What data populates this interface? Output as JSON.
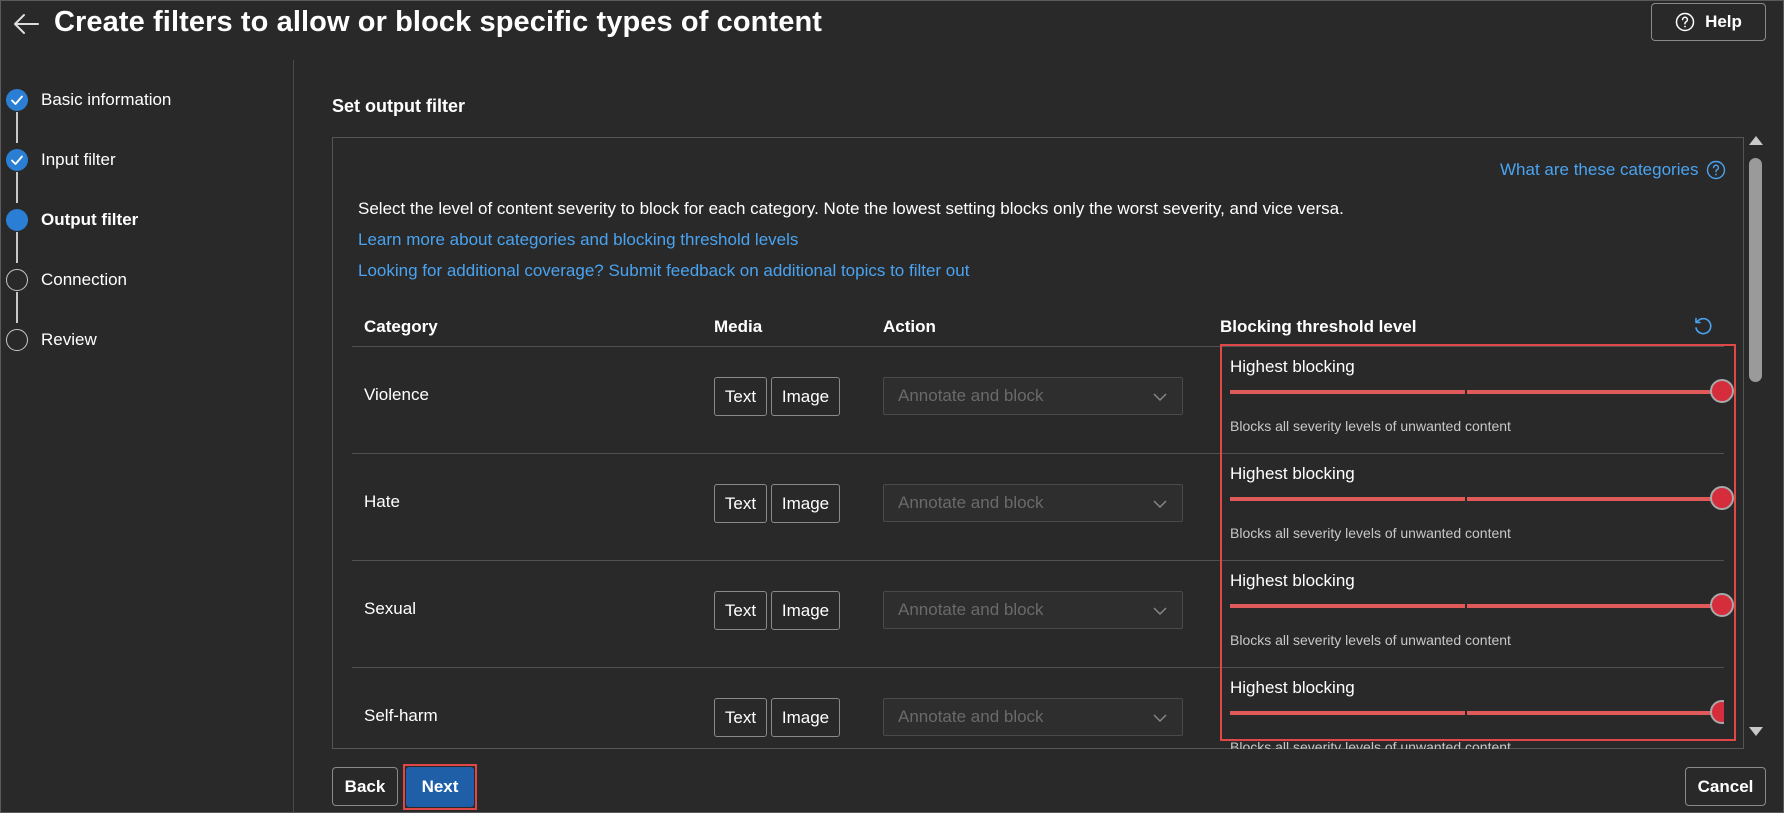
{
  "header": {
    "title": "Create filters to allow or block specific types of content",
    "help_label": "Help",
    "back_icon": "back-arrow-icon",
    "help_icon": "question-circle-icon"
  },
  "steps": [
    {
      "label": "Basic information",
      "state": "done"
    },
    {
      "label": "Input filter",
      "state": "done"
    },
    {
      "label": "Output filter",
      "state": "current"
    },
    {
      "label": "Connection",
      "state": "pending"
    },
    {
      "label": "Review",
      "state": "pending"
    }
  ],
  "main": {
    "section_title": "Set output filter",
    "what_link": "What are these categories",
    "description": "Select the level of content severity to block for each category. Note the lowest setting blocks only the worst severity, and vice versa.",
    "link_learn": "Learn more about categories and blocking threshold levels",
    "link_feedback": "Looking for additional coverage? Submit feedback on additional topics to filter out"
  },
  "table": {
    "headers": {
      "category": "Category",
      "media": "Media",
      "action": "Action",
      "threshold": "Blocking threshold level"
    },
    "media_text_label": "Text",
    "media_image_label": "Image",
    "rows": [
      {
        "category": "Violence",
        "action": "Annotate and block",
        "threshold_label": "Highest blocking",
        "threshold_level": 1.0,
        "threshold_desc": "Blocks all severity levels of unwanted content"
      },
      {
        "category": "Hate",
        "action": "Annotate and block",
        "threshold_label": "Highest blocking",
        "threshold_level": 1.0,
        "threshold_desc": "Blocks all severity levels of unwanted content"
      },
      {
        "category": "Sexual",
        "action": "Annotate and block",
        "threshold_label": "Highest blocking",
        "threshold_level": 1.0,
        "threshold_desc": "Blocks all severity levels of unwanted content"
      },
      {
        "category": "Self-harm",
        "action": "Annotate and block",
        "threshold_label": "Highest blocking",
        "threshold_level": 1.0,
        "threshold_desc": "Blocks all severity levels of unwanted content"
      }
    ]
  },
  "footer": {
    "back_label": "Back",
    "next_label": "Next",
    "cancel_label": "Cancel"
  },
  "colors": {
    "background": "#292929",
    "link": "#4aa3f0",
    "accent": "#2a7fd4",
    "slider": "#e05a5a",
    "highlight": "#e04848",
    "primary_button": "#1e5fa8"
  }
}
